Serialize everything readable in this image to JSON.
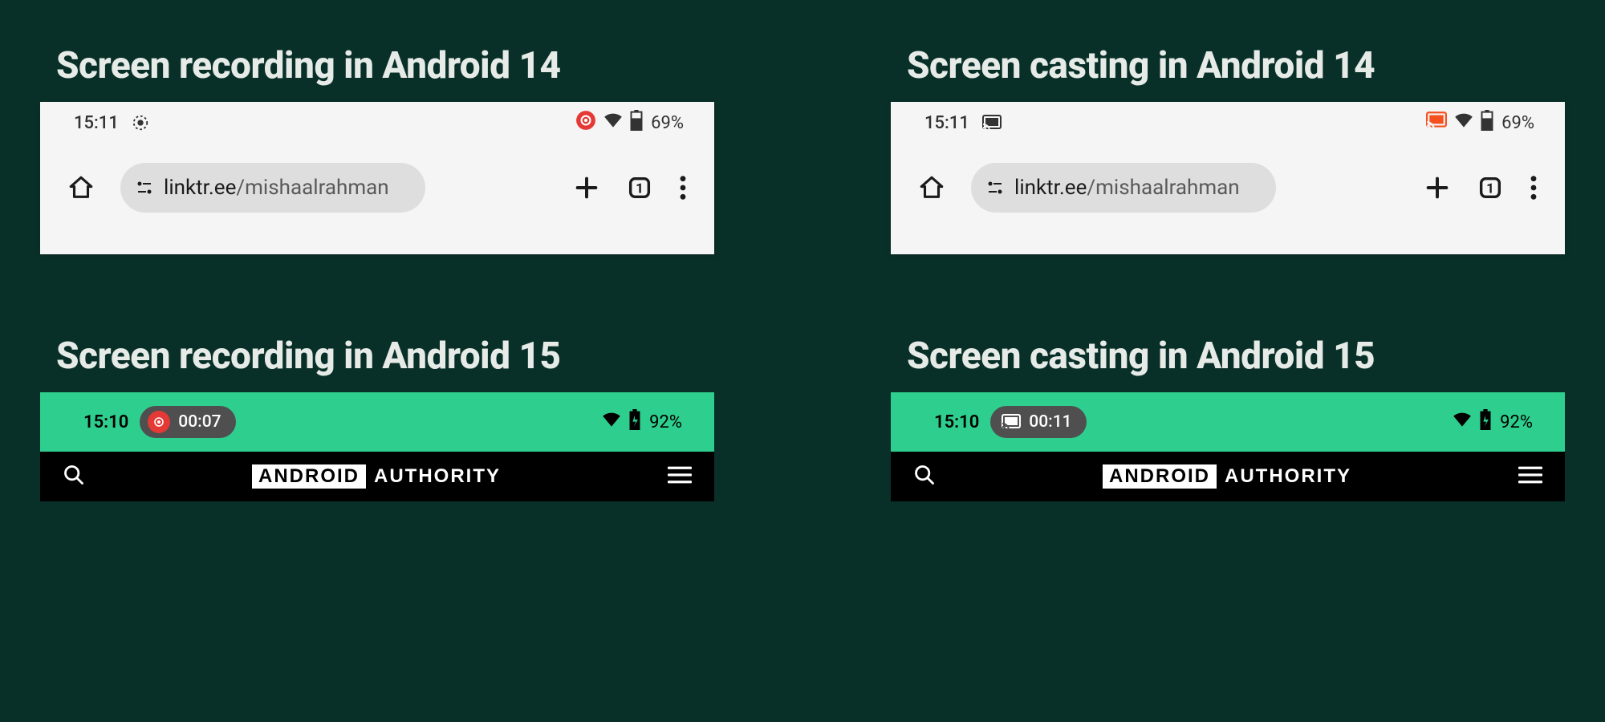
{
  "panels": {
    "rec14": {
      "title": "Screen recording in Android 14"
    },
    "cast14": {
      "title": "Screen casting in Android 14"
    },
    "rec15": {
      "title": "Screen recording in Android 15"
    },
    "cast15": {
      "title": "Screen casting in Android 15"
    }
  },
  "a14": {
    "time": "15:11",
    "battery": "69%",
    "url_host": "linktr.ee",
    "url_path": "/mishaalrahman",
    "tab_count": "1"
  },
  "a15": {
    "rec": {
      "time": "15:10",
      "chip": "00:07",
      "battery": "92%"
    },
    "cast": {
      "time": "15:10",
      "chip": "00:11",
      "battery": "92%"
    }
  },
  "aa": {
    "box": "ANDROID",
    "word": "AUTHORITY"
  },
  "colors": {
    "accent_red": "#e53935",
    "accent_orange": "#f4511e",
    "a15_green": "#2ecf8e"
  }
}
